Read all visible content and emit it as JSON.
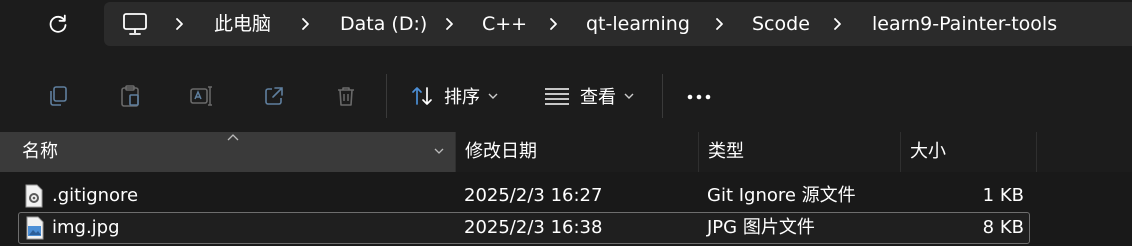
{
  "address_bar": {
    "crumbs": [
      "此电脑",
      "Data (D:)",
      "C++",
      "qt-learning",
      "Scode",
      "learn9-Painter-tools"
    ]
  },
  "toolbar": {
    "sort_label": "排序",
    "view_label": "查看"
  },
  "columns": {
    "name": "名称",
    "date": "修改日期",
    "type": "类型",
    "size": "大小"
  },
  "files": [
    {
      "name": ".gitignore",
      "date": "2025/2/3 16:27",
      "type": "Git Ignore 源文件",
      "size": "1 KB",
      "icon": "gear-file-icon",
      "selected": false
    },
    {
      "name": "img.jpg",
      "date": "2025/2/3 16:38",
      "type": "JPG 图片文件",
      "size": "8 KB",
      "icon": "image-file-icon",
      "selected": true
    }
  ],
  "colors": {
    "background": "#191919",
    "address_bg": "#2b2b2b",
    "header_active": "#3a3a3a",
    "icon_blue": "#4c8fd6"
  }
}
